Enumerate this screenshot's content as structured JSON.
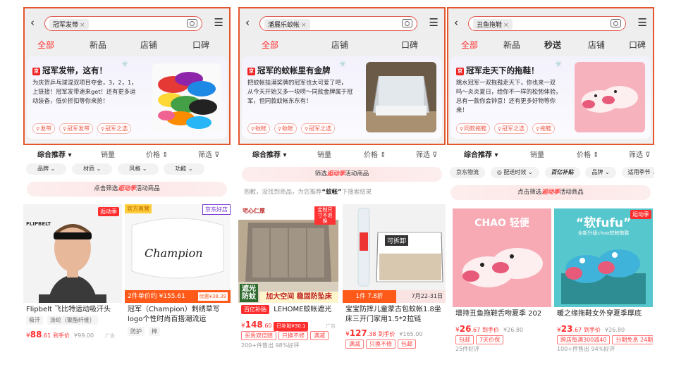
{
  "panels": [
    {
      "search_chip": "冠军发带",
      "tabs": [
        "全部",
        "新品",
        "店铺",
        "口碑"
      ],
      "card": {
        "title": "冠军发带，这有！",
        "desc": [
          "为庆贺乒乓球混双项目夺金，3，2，1，",
          "上链接！冠军发带速来get！还有更多运",
          "动装备，低价折扣等你来抢！"
        ],
        "tags": [
          "发带",
          "冠军发带",
          "冠军之选"
        ]
      },
      "sort": [
        "综合推荐",
        "销量",
        "价格",
        "筛选"
      ],
      "filters": [
        "品牌",
        "材质",
        "风格",
        "功能"
      ],
      "promo": {
        "pre": "点击筛选",
        "fw": "逅动季",
        "post": "活动商品"
      },
      "products": [
        {
          "brand_text": "FLIPBELT",
          "badge": "逅动季",
          "name": "Flipbelt 飞比特运动吸汗头",
          "labels": [
            "吸汗",
            "涤纶（聚酯纤维）"
          ],
          "price_int": "88",
          "price_dec": ".61",
          "price_suffix": "到手价",
          "old_price": "¥99.00",
          "ad": "广告"
        },
        {
          "badge_left": "官方直营",
          "badge_right": "京东好店",
          "img_text": "Champion",
          "bar_text": "2件单价约 ¥155.61",
          "bar_right": "优惠¥38.39",
          "name": "冠军（Champion）刺绣草写logo个性时尚百搭潮流运",
          "labels": [
            "防护",
            "棉"
          ]
        }
      ]
    },
    {
      "search_chip": "潘展乐蚊帐",
      "tabs": [
        "全部",
        "店铺",
        "口碑"
      ],
      "card": {
        "title": "冠军的蚊帐里有金牌",
        "desc": [
          "把蚊帐挂满奖牌的冠军也太可爱了吧，",
          "从今天开始又多一块唠～同款金牌属于冠",
          "军，但同款蚊帐东东有！"
        ],
        "tags": [
          "蚊帐",
          "蚊帐",
          "冠军之选"
        ]
      },
      "sort": [
        "综合推荐",
        "销量",
        "价格",
        "筛选"
      ],
      "promo": {
        "pre": "筛选",
        "fw": "逅动季",
        "post": "活动商品"
      },
      "hint": {
        "pre": "抱歉，没找到商品，为您推荐",
        "kw": "“蚊帐”",
        "post": "下搜索结果"
      },
      "products": [
        {
          "img_top_left": "宅心仁厚",
          "img_top_right": "定制尺寸不退换",
          "img_bottom_left": "遮光防蚊",
          "img_bottom": "加大空间 稳固防坠床",
          "badge": "百亿补贴",
          "name": "LEHOME蚊帐遮光",
          "price_int": "148",
          "price_dec": ".60",
          "price_tag": "已补贴¥30.1",
          "labels": [
            "买贵双倍赔",
            "只换不修",
            "满减"
          ],
          "sold": "200+件售出 98%好评",
          "ad": "广告"
        },
        {
          "img_text": "可拆卸",
          "bar_left": "1件 7.8折",
          "bar_right": "7月22-31日",
          "name": "宝宝防摔儿童蒙古包蚊帐1.8坐床三开门家用1.5*2拉链",
          "price_int": "127",
          "price_dec": ".38",
          "price_suffix": "到手价",
          "old_price": "¥165.00",
          "labels": [
            "满减",
            "只换不修",
            "包邮"
          ]
        }
      ]
    },
    {
      "search_chip": "丑鱼拖鞋",
      "tabs": [
        "全部",
        "新品",
        "秒送",
        "店铺",
        "口碑"
      ],
      "card": {
        "title": "冠军走天下的拖鞋！",
        "desc": [
          "跳水冠军一双拖鞋走天下，你也来一双",
          "吗～炎炎夏日，给你不一样的松弛体验，",
          "总有一款你会钟意！还有更多好物等你",
          "来！"
        ],
        "tags": [
          "同款拖鞋",
          "冠军之选",
          "拖鞋"
        ]
      },
      "sort": [
        "综合推荐",
        "销量",
        "价格",
        "筛选"
      ],
      "filters": [
        "京东物流",
        "配送时效",
        "百亿补贴",
        "品牌",
        "适用季节"
      ],
      "promo": {
        "pre": "点击筛选",
        "fw": "逅动季",
        "post": "活动商品"
      },
      "products": [
        {
          "img_title": "CHAO 轻便",
          "name": "增持丑鱼拖鞋舌吻夏季 202",
          "price_int": "26",
          "price_dec": ".67",
          "price_suffix": "到手价",
          "old_price": "¥26.80",
          "labels": [
            "包邮",
            "7天价保"
          ],
          "sold": "25件好评"
        },
        {
          "img_title": "“软fufu”",
          "img_sub": "全新升级chao软鲸拖鞋",
          "badge": "逅动季",
          "name": "暖之缘拖鞋女外穿夏季厚底",
          "price_int": "23",
          "price_dec": ".67",
          "price_suffix": "到手价",
          "old_price": "¥26.80",
          "labels": [
            "跨店每满300减40",
            "分期免息 24期"
          ],
          "sold": "100+件售出 94%好评"
        }
      ]
    }
  ],
  "colors": {
    "accent": "#ff2e2e",
    "frame": "#e4572e",
    "orange": "#ff5a1a"
  }
}
